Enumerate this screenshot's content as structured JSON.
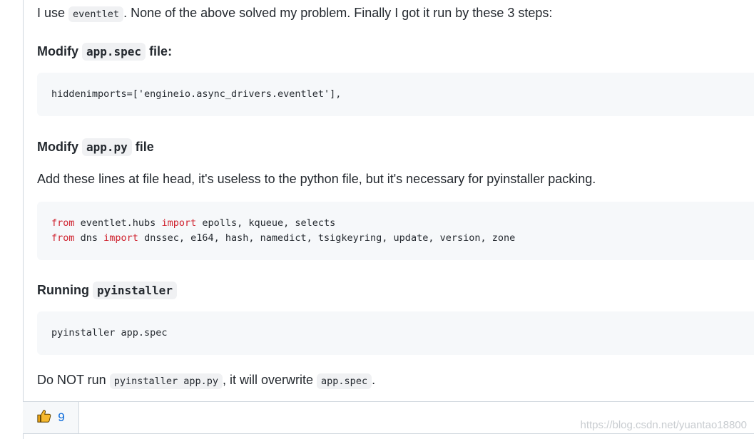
{
  "intro": {
    "pre": "I use ",
    "code": "eventlet",
    "post": ". None of the above solved my problem. Finally I got it run by these 3 steps:"
  },
  "step1": {
    "pre": "Modify ",
    "code": "app.spec",
    "post": " file:",
    "codeblock": [
      "hiddenimports=['engineio.async_drivers.eventlet'],"
    ]
  },
  "step2": {
    "pre": "Modify ",
    "code": "app.py",
    "post": " file",
    "description": "Add these lines at file head, it's useless to the python file, but it's necessary for pyinstaller packing.",
    "codeblock": [
      {
        "kw1": "from",
        "mod": " eventlet.hubs ",
        "kw2": "import",
        "rest": " epolls, kqueue, selects"
      },
      {
        "kw1": "from",
        "mod": " dns ",
        "kw2": "import",
        "rest": " dnssec, e164, hash, namedict, tsigkeyring, update, version, zone"
      }
    ]
  },
  "step3": {
    "pre": "Running ",
    "code": "pyinstaller",
    "codeblock": [
      "pyinstaller app.spec"
    ]
  },
  "note": {
    "pre": "Do NOT run ",
    "code1": "pyinstaller app.py",
    "mid": ", it will overwrite ",
    "code2": "app.spec",
    "post": "."
  },
  "votes": {
    "count": "9",
    "icon": "thumbs-up-icon",
    "icon_color": "#e8a317"
  },
  "watermark": "https://blog.csdn.net/yuantao18800"
}
